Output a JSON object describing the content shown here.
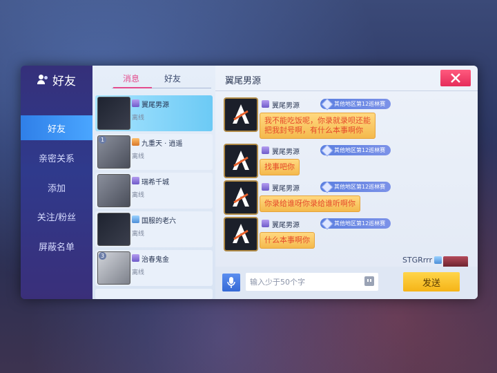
{
  "nav": {
    "title": "好友",
    "items": [
      {
        "label": "好友",
        "active": true
      },
      {
        "label": "亲密关系",
        "active": false
      },
      {
        "label": "添加",
        "active": false
      },
      {
        "label": "关注/粉丝",
        "active": false
      },
      {
        "label": "屏蔽名单",
        "active": false
      }
    ]
  },
  "list": {
    "tabs": [
      {
        "label": "消息",
        "active": true
      },
      {
        "label": "好友",
        "active": false
      }
    ],
    "rows": [
      {
        "name": "翼尾男源",
        "status": "离线",
        "level": ""
      },
      {
        "name": "九重天 · 逍遥",
        "status": "离线",
        "level": "1"
      },
      {
        "name": "瑞希千城",
        "status": "离线",
        "level": ""
      },
      {
        "name": "国服的老六",
        "status": "离线",
        "level": ""
      },
      {
        "name": "治春鬼金",
        "status": "离线",
        "level": "3"
      }
    ]
  },
  "chat": {
    "title": "翼尾男源",
    "messages": [
      {
        "name": "翼尾男源",
        "badge": "其他地区第12巡林赛",
        "line1": "我不能吃饭呢，你录就录呗还能",
        "line2": "把我封号啊，有什么本事啊你"
      },
      {
        "name": "翼尾男源",
        "badge": "其他地区第12巡林赛",
        "line1": "找事吧你",
        "line2": ""
      },
      {
        "name": "翼尾男源",
        "badge": "其他地区第12巡林赛",
        "line1": "你录给谁呀你录给谁听啊你",
        "line2": ""
      },
      {
        "name": "翼尾男源",
        "badge": "其他地区第12巡林赛",
        "line1": "什么本事啊你",
        "line2": ""
      }
    ],
    "self_name": "STGRrrr",
    "input_placeholder": "输入少于50个字",
    "send_label": "发送"
  },
  "colors": {
    "accent": "#e44b8c",
    "send": "#f5b417",
    "bubble": "#ffd980",
    "active_nav": "#3b8ef0"
  }
}
